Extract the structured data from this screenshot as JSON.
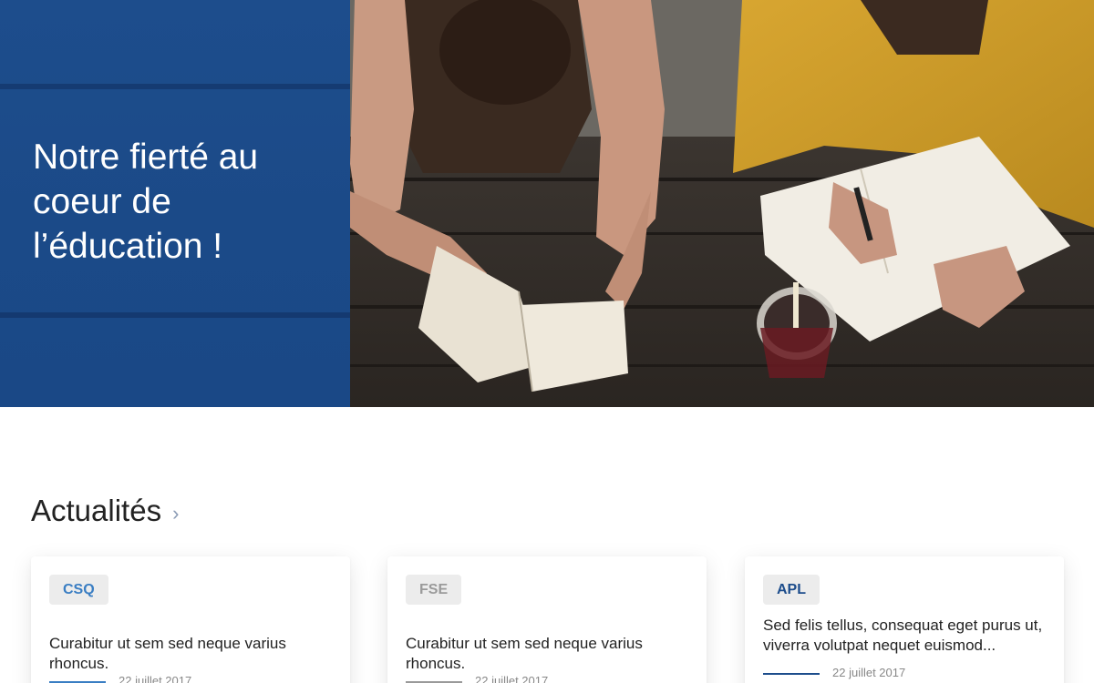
{
  "hero": {
    "title": "Notre fierté au coeur de l’éducation !",
    "panel_color": "#1d4d8c",
    "image": "photo of two students reading and writing at a wooden table"
  },
  "news": {
    "heading": "Actualités",
    "chevron": "›",
    "cards": [
      {
        "tag": "CSQ",
        "tag_color": "#3a7ec3",
        "title": "Curabitur ut sem sed neque varius rhoncus.",
        "date": "22 juillet 2017",
        "accent": "#3a7ec3"
      },
      {
        "tag": "FSE",
        "tag_color": "#9a9a9a",
        "title": "Curabitur ut sem sed neque varius rhoncus.",
        "date": "22 juillet 2017",
        "accent": "#9a9a9a"
      },
      {
        "tag": "APL",
        "tag_color": "#1d4d8c",
        "title": "Sed felis tellus, consequat eget purus ut, viverra volutpat nequet euismod...",
        "date": "22 juillet 2017",
        "accent": "#1d4d8c"
      }
    ]
  }
}
